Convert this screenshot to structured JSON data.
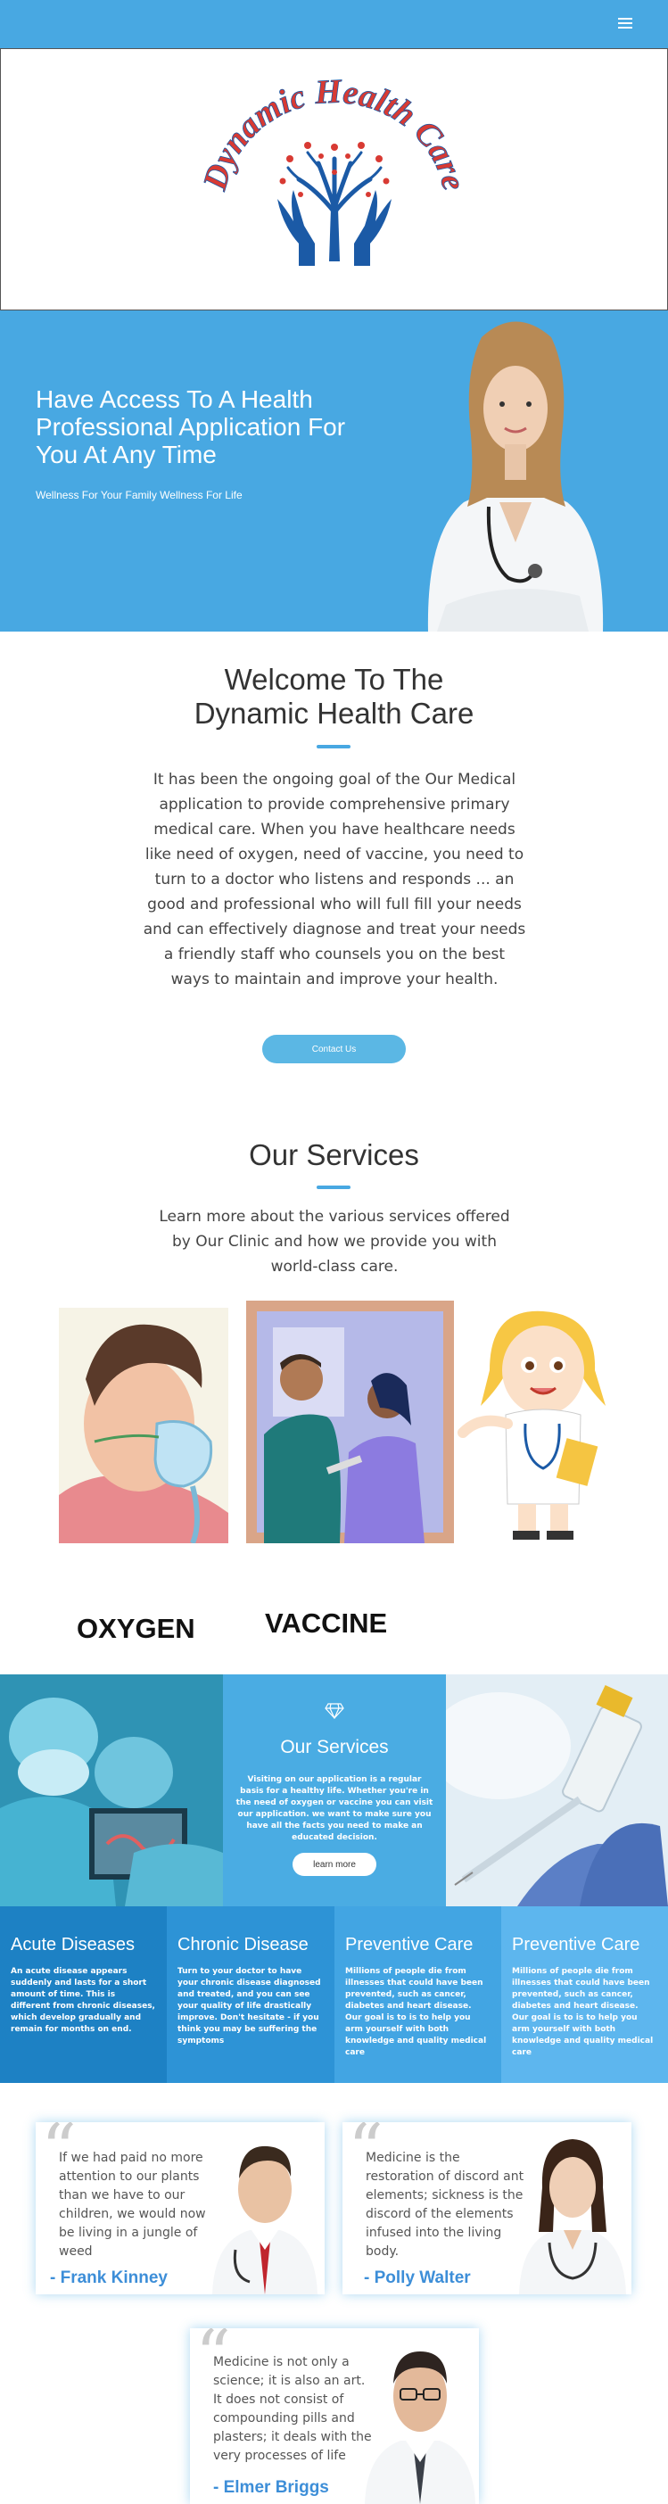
{
  "header": {
    "menu_icon": "hamburger-menu-icon"
  },
  "logo": {
    "text": "Dynamic Health Care",
    "colors": {
      "text": "#d83a33",
      "tree": "#1b5aa6",
      "stars": "#d83a33"
    }
  },
  "hero": {
    "title": "Have Access To A Health Professional Application For You At Any Time",
    "subtitle": "Wellness For Your Family Wellness For Life"
  },
  "welcome": {
    "title_line1": "Welcome To The",
    "title_line2": "Dynamic Health Care",
    "body": "It has been the ongoing goal of the Our Medical application to provide comprehensive primary medical care. When you have healthcare needs like need of oxygen, need of vaccine, you need to turn to a doctor who listens and responds ... an good and  professional who will full fill your needs  and can effectively diagnose and treat your needs a friendly staff who counsels you on the best ways to maintain and improve your health.",
    "button": "Contact Us"
  },
  "services": {
    "title": "Our Services",
    "body": "Learn more about the various services offered by Our Clinic and how we provide you with world-class care.",
    "items": [
      {
        "label": "OXYGEN"
      },
      {
        "label": "VACCINE"
      }
    ]
  },
  "feature": {
    "title": "Our Services",
    "body": "Visiting on our application is a  regular basis  for a healthy life. Whether you're in the need of oxygen or vaccine you can visit our application. we want to make sure you have all the facts you need to make an educated decision.",
    "button": "learn more"
  },
  "columns": [
    {
      "title": "Acute Diseases",
      "text": "An acute disease appears suddenly and lasts for a short amount of time. This is different from chronic diseases, which develop gradually and remain for months on end.",
      "color": "#1d81c4"
    },
    {
      "title": "Chronic Disease",
      "text": "Turn to your doctor to have your chronic disease diagnosed and treated, and you can see your quality of life drastically improve. Don't hesitate - if you think you may be suffering the symptoms",
      "color": "#2d93d6"
    },
    {
      "title": "Preventive Care",
      "text": "Millions of people die from illnesses that could have been prevented, such as cancer, diabetes and heart disease. Our goal is to is to help you arm yourself with both knowledge and quality medical care",
      "color": "#42a5e3"
    },
    {
      "title": "Preventive Care",
      "text": "Millions of people die from illnesses that could have been prevented, such as cancer, diabetes and heart disease. Our goal is to is to help you arm yourself with both knowledge and quality medical care",
      "color": "#5db6ee"
    }
  ],
  "testimonials": [
    {
      "quote": "If we had paid no more attention to our plants than we have to our children, we would now be living in a jungle of weed",
      "name": "- Frank Kinney"
    },
    {
      "quote": "Medicine is the restoration of discord ant elements; sickness is the discord of the elements infused into the living body.",
      "name": "- Polly Walter"
    },
    {
      "quote": "Medicine is not only a science; it is also an art. It does not consist of compounding pills and plasters; it deals with the very processes of life",
      "name": "- Elmer Briggs"
    }
  ]
}
